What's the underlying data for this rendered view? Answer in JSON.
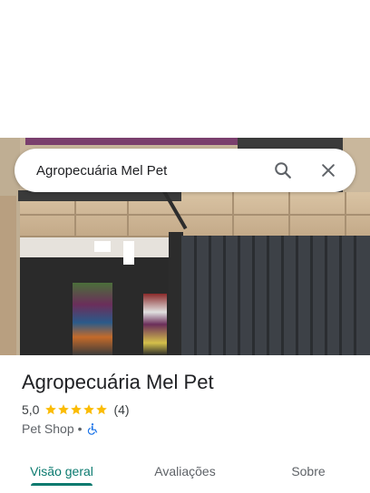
{
  "search": {
    "query": "Agropecuária Mel Pet",
    "search_icon": "search-icon",
    "close_icon": "close-icon"
  },
  "photo": {
    "description_icon": "storefront-photo"
  },
  "place": {
    "name": "Agropecuária Mel Pet",
    "rating": "5,0",
    "stars": 5,
    "reviews_count": "(4)",
    "category": "Pet Shop",
    "separator": "•",
    "accessibility_icon": "wheelchair-icon"
  },
  "tabs": [
    {
      "label": "Visão geral",
      "active": true
    },
    {
      "label": "Avaliações",
      "active": false
    },
    {
      "label": "Sobre",
      "active": false
    }
  ],
  "colors": {
    "accent": "#0b7a6f",
    "star": "#fbbc04",
    "accessibility": "#1a73e8"
  }
}
